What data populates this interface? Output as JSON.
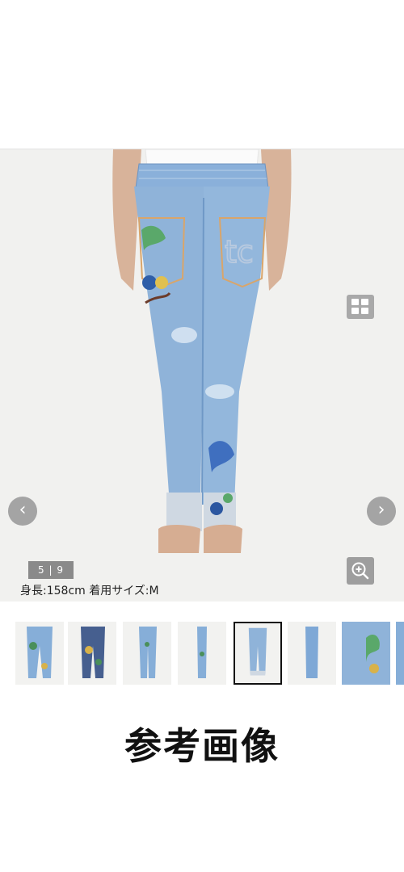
{
  "gallery": {
    "counter": "5 | 9",
    "caption": "身長:158cm 着用サイズ:M",
    "prev_label": "‹",
    "next_label": "›",
    "thumbnails": [
      {
        "label": "thumbnail-1"
      },
      {
        "label": "thumbnail-2"
      },
      {
        "label": "thumbnail-3"
      },
      {
        "label": "thumbnail-4"
      },
      {
        "label": "thumbnail-5"
      },
      {
        "label": "thumbnail-6"
      },
      {
        "label": "thumbnail-7"
      },
      {
        "label": "thumbnail-8"
      }
    ],
    "selected_index": 4
  },
  "icons": {
    "grid": "grid-icon",
    "zoom": "zoom-in-icon",
    "prev": "chevron-left-icon",
    "next": "chevron-right-icon"
  },
  "banner": {
    "text": "参考画像"
  },
  "colors": {
    "denim": "#8fb3d9",
    "denim_dark": "#6f98c6",
    "overlay": "#a0a0a0"
  }
}
